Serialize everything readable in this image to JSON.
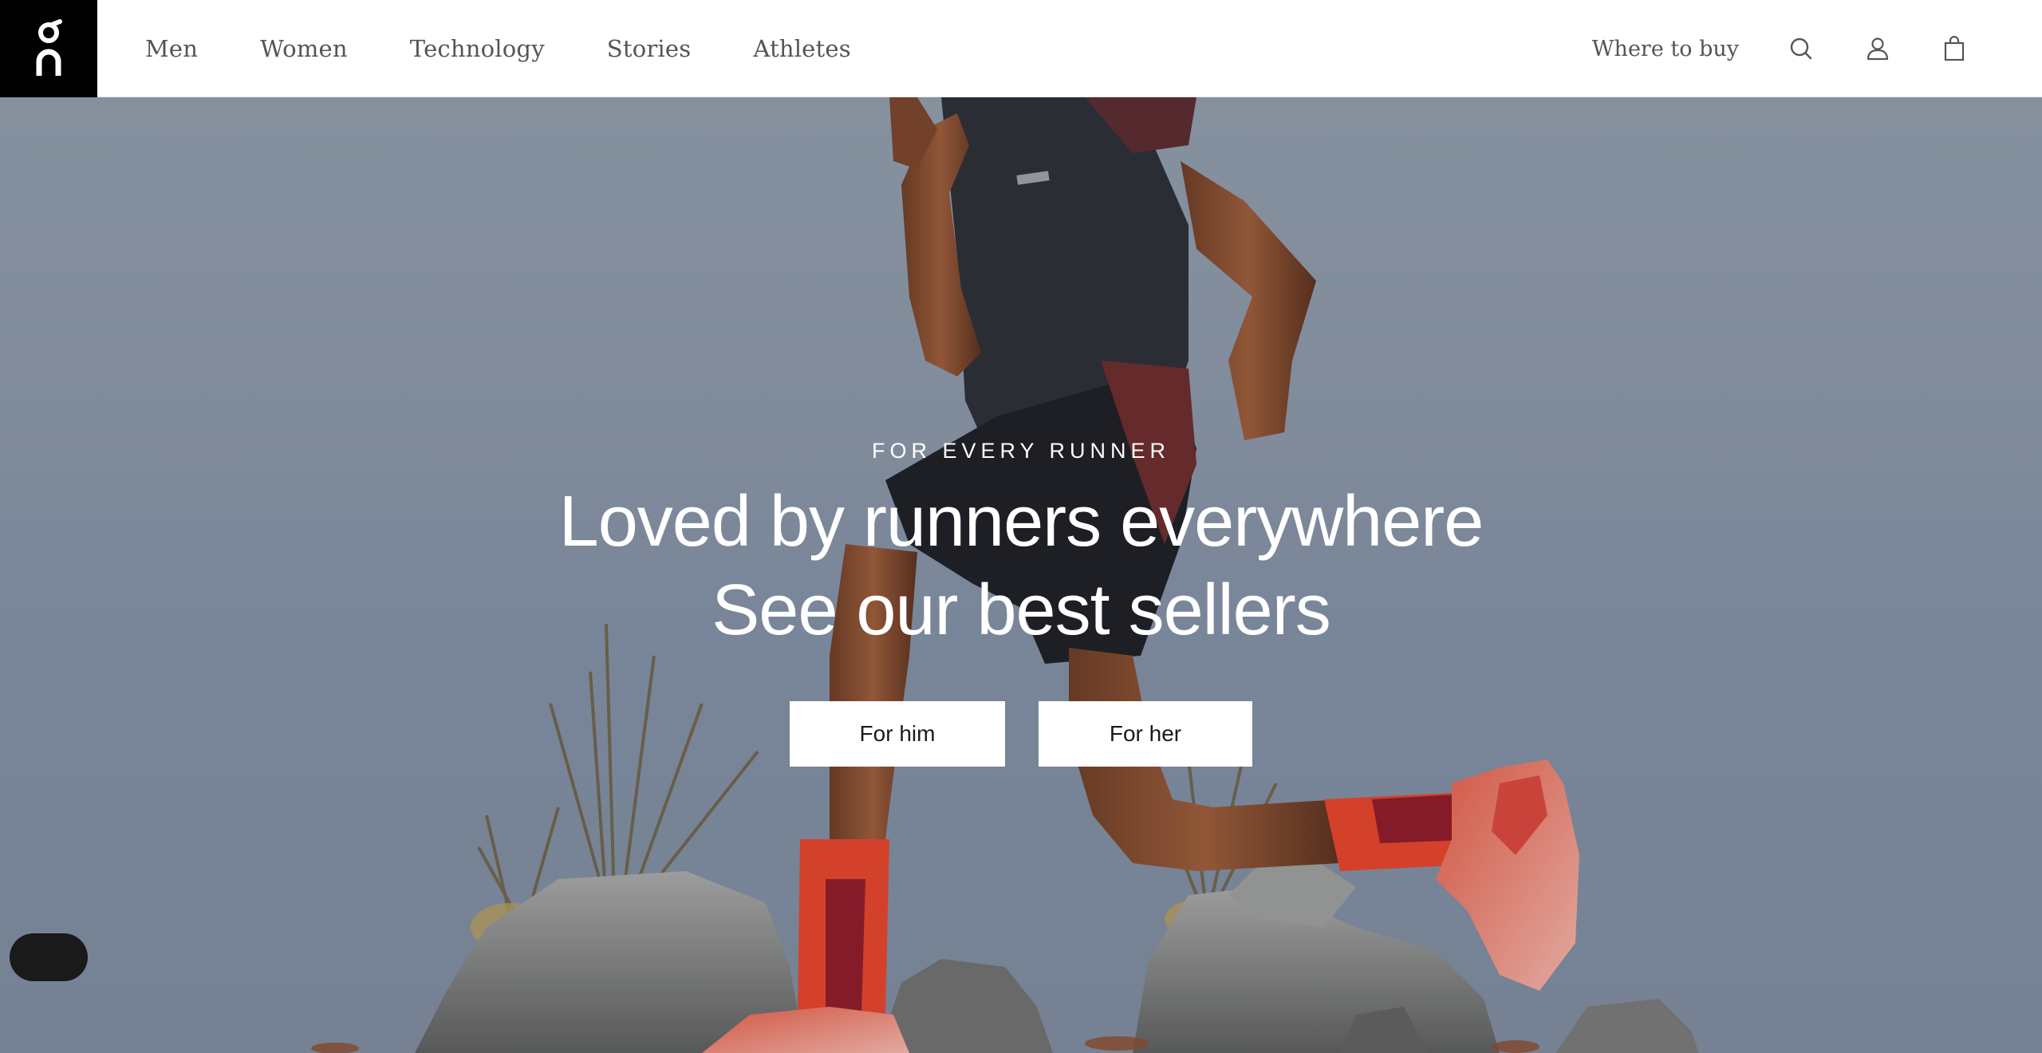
{
  "header": {
    "logo_icon": "on-logo-icon",
    "nav": [
      {
        "label": "Men"
      },
      {
        "label": "Women"
      },
      {
        "label": "Technology"
      },
      {
        "label": "Stories"
      },
      {
        "label": "Athletes"
      }
    ],
    "where_to_buy": "Where to buy",
    "icons": [
      "search-icon",
      "account-icon",
      "bag-icon"
    ]
  },
  "hero": {
    "eyebrow": "FOR EVERY RUNNER",
    "headline_line1": "Loved by runners everywhere",
    "headline_line2": "See our best sellers",
    "cta_him": "For him",
    "cta_her": "For her"
  },
  "colors": {
    "logo_bg": "#000000",
    "nav_text": "#555555",
    "hero_sky": "#8893a3",
    "cta_bg": "#ffffff",
    "cta_text": "#1a1a1a",
    "sock_red": "#e2432a"
  }
}
